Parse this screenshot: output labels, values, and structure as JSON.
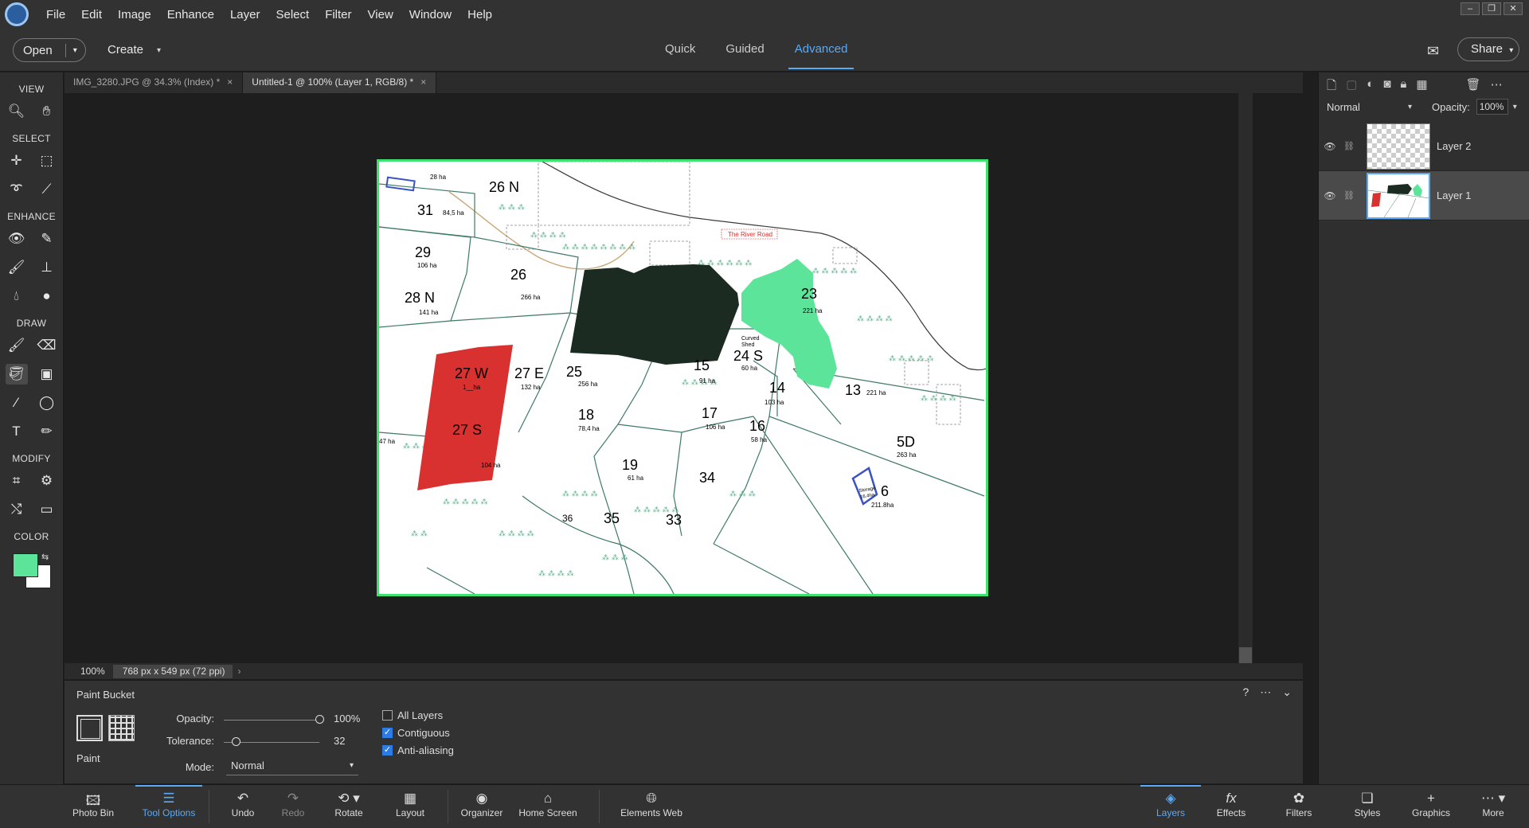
{
  "menu": {
    "items": [
      "File",
      "Edit",
      "Image",
      "Enhance",
      "Layer",
      "Select",
      "Filter",
      "View",
      "Window",
      "Help"
    ]
  },
  "window_controls": [
    "–",
    "❐",
    "✕"
  ],
  "topbar": {
    "open_label": "Open",
    "create_label": "Create",
    "modes": [
      "Quick",
      "Guided",
      "Advanced"
    ],
    "active_mode": "Advanced",
    "share_label": "Share"
  },
  "toolbox": {
    "sections": {
      "view": "VIEW",
      "select": "SELECT",
      "enhance": "ENHANCE",
      "draw": "DRAW",
      "modify": "MODIFY",
      "color": "COLOR"
    },
    "foreground_color": "#5ce59a",
    "background_color": "#ffffff"
  },
  "tabs": [
    {
      "label": "IMG_3280.JPG @ 34.3% (Index) *"
    },
    {
      "label": "Untitled-1 @ 100% (Layer 1, RGB/8) *"
    }
  ],
  "status": {
    "zoom": "100%",
    "dimensions": "768 px x 549 px (72 ppi)"
  },
  "map": {
    "road_label": "The River Road",
    "shed_label": "Curved\nShed",
    "storage_label": "Storage\n16.4ha",
    "colors": {
      "dark": "#1b2b22",
      "red": "#d93030",
      "green": "#5ce59a",
      "road": "#c8a878",
      "blue": "#3b52c4"
    },
    "paddocks": [
      {
        "num": "26 N",
        "area": "28 ha"
      },
      {
        "num": "31",
        "area": "84,5 ha"
      },
      {
        "num": "29",
        "area": "106 ha"
      },
      {
        "num": "26",
        "area": "266 ha"
      },
      {
        "num": "28 N",
        "area": "141 ha"
      },
      {
        "num": "23",
        "area": "221 ha"
      },
      {
        "num": "27 W",
        "area": "1__ha"
      },
      {
        "num": "27 E",
        "area": "132 ha"
      },
      {
        "num": "25",
        "area": "256 ha"
      },
      {
        "num": "15",
        "area": "91 ha"
      },
      {
        "num": "24 S",
        "area": "60 ha"
      },
      {
        "num": "14",
        "area": "103 ha"
      },
      {
        "num": "13",
        "area": "221 ha"
      },
      {
        "num": "18",
        "area": "78,4 ha"
      },
      {
        "num": "17",
        "area": "106 ha"
      },
      {
        "num": "16",
        "area": "58 ha"
      },
      {
        "num": "27 S",
        "area": "104 ha"
      },
      {
        "num": "5D",
        "area": "263 ha"
      },
      {
        "num": "19",
        "area": "61 ha"
      },
      {
        "num": "34",
        "area": ""
      },
      {
        "num": "6",
        "area": "211.8ha"
      },
      {
        "num": "36",
        "area": ""
      },
      {
        "num": "35",
        "area": ""
      },
      {
        "num": "33",
        "area": ""
      }
    ],
    "small_labels": [
      "47 ha"
    ]
  },
  "layers_panel": {
    "blend_mode": "Normal",
    "opacity_label": "Opacity:",
    "opacity_value": "100%",
    "layers": [
      {
        "name": "Layer 2",
        "active": false
      },
      {
        "name": "Layer 1",
        "active": true
      }
    ]
  },
  "tool_options": {
    "title": "Paint Bucket",
    "paint_label": "Paint",
    "opacity_label": "Opacity:",
    "opacity_value": "100%",
    "opacity_level": 1.0,
    "tolerance_label": "Tolerance:",
    "tolerance_value": "32",
    "tolerance_level": 0.128,
    "mode_label": "Mode:",
    "mode_value": "Normal",
    "all_layers_label": "All Layers",
    "all_layers_checked": false,
    "contiguous_label": "Contiguous",
    "contiguous_checked": true,
    "antialias_label": "Anti-aliasing",
    "antialias_checked": true
  },
  "bottombar": [
    {
      "label": "Photo Bin",
      "icon": "photo-bin-icon"
    },
    {
      "label": "Tool Options",
      "icon": "tool-options-icon",
      "active": true
    },
    {
      "label": "Undo",
      "icon": "undo-icon"
    },
    {
      "label": "Redo",
      "icon": "redo-icon"
    },
    {
      "label": "Rotate",
      "icon": "rotate-icon"
    },
    {
      "label": "Layout",
      "icon": "layout-icon"
    },
    {
      "label": "Organizer",
      "icon": "organizer-icon"
    },
    {
      "label": "Home Screen",
      "icon": "home-icon"
    },
    {
      "label": "Elements Web",
      "icon": "globe-icon"
    },
    {
      "label": "Layers",
      "icon": "layers-icon",
      "active": true
    },
    {
      "label": "Effects",
      "icon": "fx-icon"
    },
    {
      "label": "Filters",
      "icon": "filters-icon"
    },
    {
      "label": "Styles",
      "icon": "styles-icon"
    },
    {
      "label": "Graphics",
      "icon": "plus-icon"
    },
    {
      "label": "More",
      "icon": "more-icon"
    }
  ]
}
